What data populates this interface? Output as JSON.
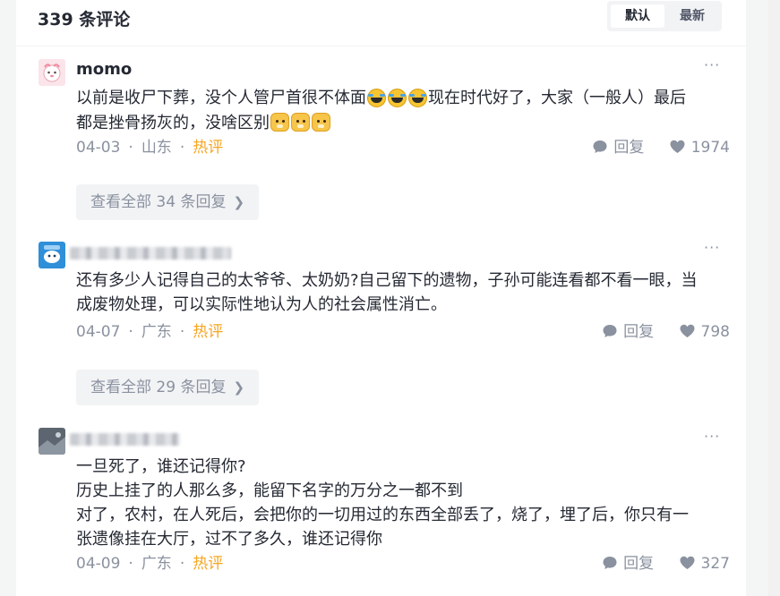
{
  "header": {
    "title": "339 条评论",
    "sort": {
      "default_label": "默认",
      "latest_label": "最新",
      "selected": "默认"
    }
  },
  "comments": [
    {
      "user": {
        "name": "momo",
        "avatar_icon": "pink-character-avatar",
        "name_blurred": false
      },
      "lines": [
        "以前是收尸下葬，没个人管尸首很不体面",
        "现在时代好了，大家（一般人）最后",
        "都是挫骨扬灰的，没啥区别"
      ],
      "emoji_groups": {
        "after_line_0": [
          "laughing-tears-emoji",
          "laughing-tears-emoji",
          "laughing-tears-emoji"
        ],
        "after_line_2": [
          "dog-face-emoji",
          "dog-face-emoji",
          "dog-face-emoji"
        ]
      },
      "date": "04-03",
      "region": "山东",
      "badge": "热评",
      "reply_label": "回复",
      "likes": "1974",
      "replies_button": "查看全部 34 条回复"
    },
    {
      "user": {
        "name": "",
        "avatar_icon": "blue-cartoon-avatar",
        "name_blurred": true
      },
      "lines": [
        "还有多少人记得自己的太爷爷、太奶奶?自己留下的遗物，子孙可能连看都不看一眼，当",
        "成废物处理，可以实际性地认为人的社会属性消亡。"
      ],
      "date": "04-07",
      "region": "广东",
      "badge": "热评",
      "reply_label": "回复",
      "likes": "798",
      "replies_button": "查看全部 29 条回复"
    },
    {
      "user": {
        "name": "",
        "avatar_icon": "grey-photo-avatar",
        "name_blurred": true
      },
      "lines": [
        "一旦死了，谁还记得你?",
        "历史上挂了的人那么多，能留下名字的万分之一都不到",
        "对了，农村，在人死后，会把你的一切用过的东西全部丢了，烧了，埋了后，你只有一",
        "张遗像挂在大厅，过不了多久，谁还记得你"
      ],
      "date": "04-09",
      "region": "广东",
      "badge": "热评",
      "reply_label": "回复",
      "likes": "327"
    }
  ],
  "icons": {
    "more": "more-dots-icon",
    "reply": "comment-bubble-icon",
    "like": "heart-icon",
    "chevron": "chevron-right-icon"
  },
  "colors": {
    "hot_badge": "#f5a623",
    "meta_text": "#8a919f",
    "primary_text": "#252933"
  }
}
